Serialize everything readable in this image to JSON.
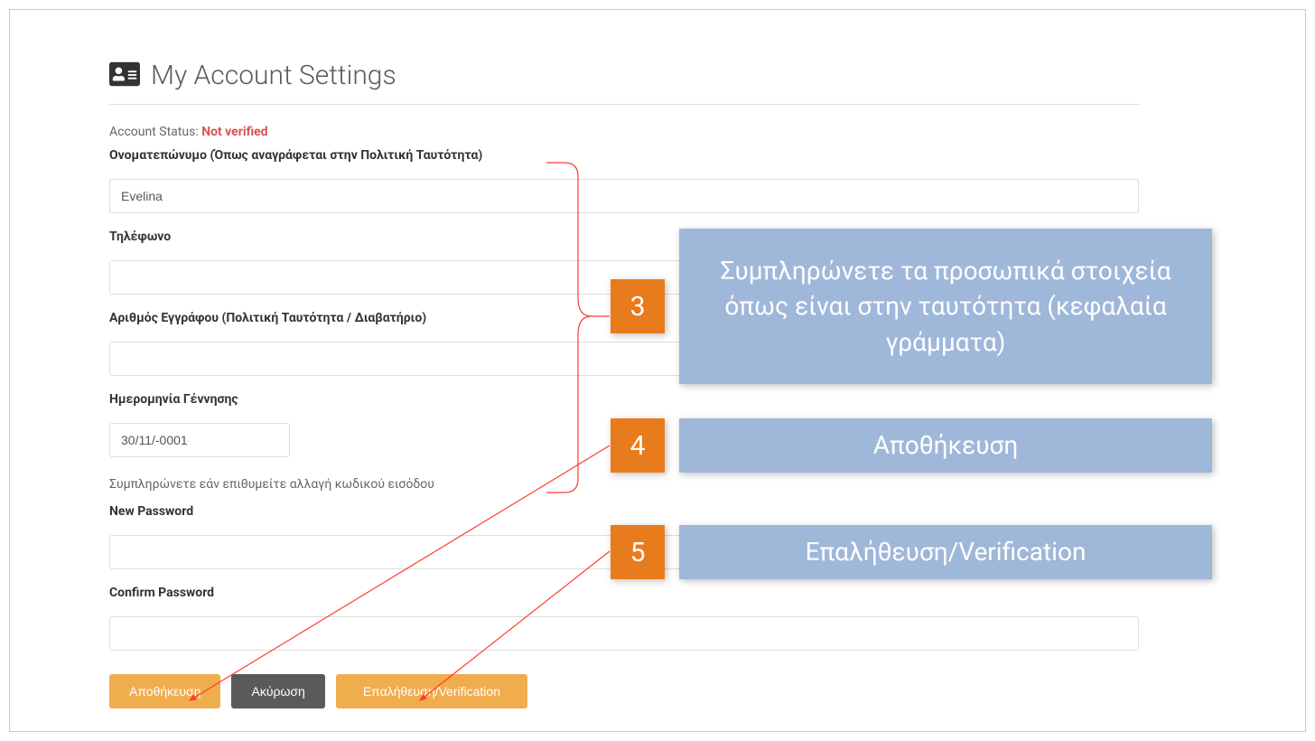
{
  "header": {
    "title": "My Account Settings"
  },
  "status": {
    "label": "Account Status:",
    "value": "Not verified"
  },
  "form": {
    "fullname": {
      "label": "Ονοματεπώνυμο (Όπως αναγράφεται στην Πολιτική Ταυτότητα)",
      "value": "Evelina"
    },
    "phone": {
      "label": "Τηλέφωνο",
      "value": ""
    },
    "doc_number": {
      "label": "Αριθμός Εγγράφου (Πολιτική Ταυτότητα / Διαβατήριο)",
      "value": ""
    },
    "birthdate": {
      "label": "Ημερομηνία Γέννησης",
      "value": "30/11/-0001"
    },
    "password_note": "Συμπληρώνετε εάν επιθυμείτε αλλαγή κωδικού εισόδου",
    "new_password": {
      "label": "New Password",
      "value": ""
    },
    "confirm_password": {
      "label": "Confirm Password",
      "value": ""
    }
  },
  "buttons": {
    "save": "Αποθήκευση",
    "cancel": "Ακύρωση",
    "verify": "Επαλήθευση/Verification"
  },
  "callouts": {
    "c3": {
      "num": "3",
      "text": "Συμπληρώνετε τα προσωπικά στοιχεία όπως είναι στην ταυτότητα (κεφαλαία γράμματα)"
    },
    "c4": {
      "num": "4",
      "text": "Αποθήκευση"
    },
    "c5": {
      "num": "5",
      "text": "Επαλήθευση/Verification"
    }
  },
  "colors": {
    "danger": "#d9534f",
    "btn_orange": "#f0ad4e",
    "btn_dark": "#5a5a5a",
    "callout_orange": "#e87b1c",
    "callout_blue": "#9fb7d9",
    "annotation_red": "#ff3b30"
  }
}
